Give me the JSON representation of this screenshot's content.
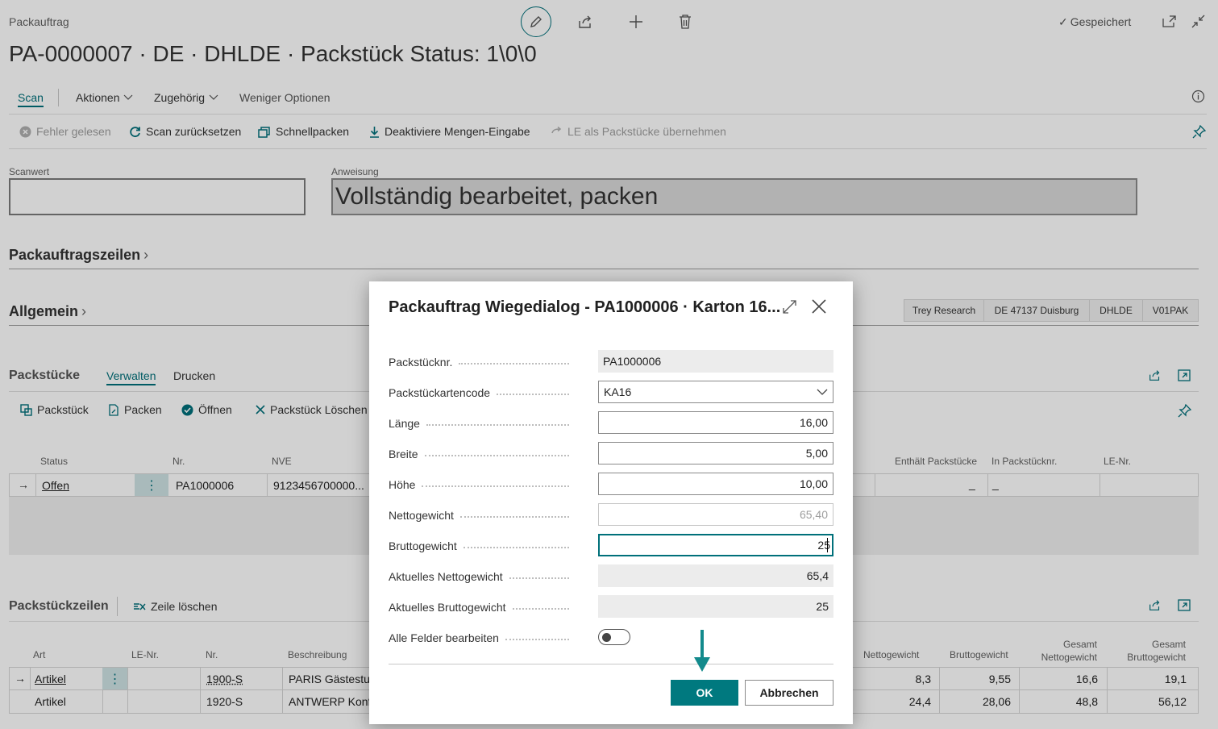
{
  "page": {
    "breadcrumb": "Packauftrag",
    "title": "PA-0000007 · DE · DHLDE · Packstück Status: 1\\0\\0",
    "saved_label": "Gespeichert",
    "check_glyph": "✓"
  },
  "nav": {
    "scan": "Scan",
    "aktionen": "Aktionen",
    "zugehoerig": "Zugehörig",
    "weniger": "Weniger Optionen"
  },
  "toolbar": {
    "fehler": "Fehler gelesen",
    "scan_reset": "Scan zurücksetzen",
    "schnellpacken": "Schnellpacken",
    "deaktiviere": "Deaktiviere Mengen-Eingabe",
    "le_uebernehmen": "LE als Packstücke übernehmen"
  },
  "fields": {
    "scanwert_label": "Scanwert",
    "scanwert_value": "",
    "anweisung_label": "Anweisung",
    "anweisung_value": "Vollständig bearbeitet, packen"
  },
  "sections": {
    "packauftragszeilen": "Packauftragszeilen",
    "allgemein": "Allgemein",
    "chevron": "›"
  },
  "factboxes": [
    "Trey Research",
    "DE 47137 Duisburg",
    "DHLDE",
    "V01PAK"
  ],
  "packstuecke": {
    "title": "Packstücke",
    "tab_verwalten": "Verwalten",
    "tab_drucken": "Drucken",
    "actions": {
      "packstueck": "Packstück",
      "packen": "Packen",
      "oeffnen": "Öffnen",
      "loeschen": "Packstück Löschen"
    },
    "columns": {
      "status": "Status",
      "nr": "Nr.",
      "nve": "NVE",
      "enthaelt": "Enthält Packstücke",
      "in_packstuecknr": "In Packstücknr.",
      "le_nr": "LE-Nr."
    },
    "row": {
      "status": "Offen",
      "nr": "PA1000006",
      "nve": "9123456700000...",
      "enthaelt": "_",
      "in_packstuecknr": "_"
    }
  },
  "packstueckzeilen": {
    "title": "Packstückzeilen",
    "delete_line": "Zeile löschen",
    "columns": {
      "art": "Art",
      "le_nr": "LE-Nr.",
      "nr": "Nr.",
      "beschreibung": "Beschreibung",
      "nettogewicht": "Nettogewicht",
      "bruttogewicht": "Bruttogewicht",
      "gesamt_netto_1": "Gesamt",
      "gesamt_netto_2": "Nettogewicht",
      "gesamt_brutto_1": "Gesamt",
      "gesamt_brutto_2": "Bruttogewicht"
    },
    "rows": [
      {
        "art": "Artikel",
        "nr": "1900-S",
        "beschreibung": "PARIS Gästestuhl",
        "netto": "8,3",
        "brutto": "9,55",
        "g_netto": "16,6",
        "g_brutto": "19,1"
      },
      {
        "art": "Artikel",
        "nr": "1920-S",
        "beschreibung": "ANTWERP Konferenztisch",
        "netto": "24,4",
        "brutto": "28,06",
        "g_netto": "48,8",
        "g_brutto": "56,12"
      }
    ]
  },
  "dialog": {
    "title": "Packauftrag Wiegedialog - PA1000006 · Karton 16...",
    "labels": {
      "packstuecknr": "Packstücknr.",
      "artencode": "Packstückartencode",
      "laenge": "Länge",
      "breite": "Breite",
      "hoehe": "Höhe",
      "netto": "Nettogewicht",
      "brutto": "Bruttogewicht",
      "akt_netto": "Aktuelles Nettogewicht",
      "akt_brutto": "Aktuelles Bruttogewicht",
      "alle_felder": "Alle Felder bearbeiten"
    },
    "values": {
      "packstuecknr": "PA1000006",
      "artencode": "KA16",
      "laenge": "16,00",
      "breite": "5,00",
      "hoehe": "10,00",
      "netto": "65,40",
      "brutto": "25",
      "akt_netto": "65,4",
      "akt_brutto": "25"
    },
    "toggle_on": false,
    "ok": "OK",
    "cancel": "Abbrechen"
  },
  "colors": {
    "accent": "#00707a",
    "ok_button": "#00797f",
    "arrow": "#138a8c"
  }
}
